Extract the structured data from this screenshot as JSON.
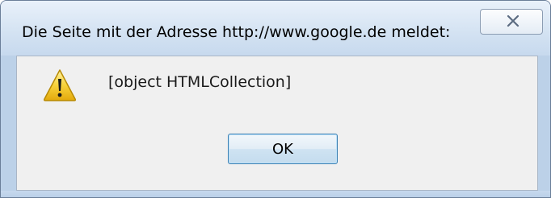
{
  "dialog": {
    "title": "Die Seite mit der Adresse http://www.google.de meldet:",
    "message": "[object HTMLCollection]",
    "ok_label": "OK",
    "icon": "warning-icon",
    "close_icon": "close-icon"
  },
  "colors": {
    "frame": "#bcd1e8",
    "content_bg": "#f0f0f0",
    "warning_fill": "#f5c518",
    "button_border": "#3c7fb1"
  }
}
